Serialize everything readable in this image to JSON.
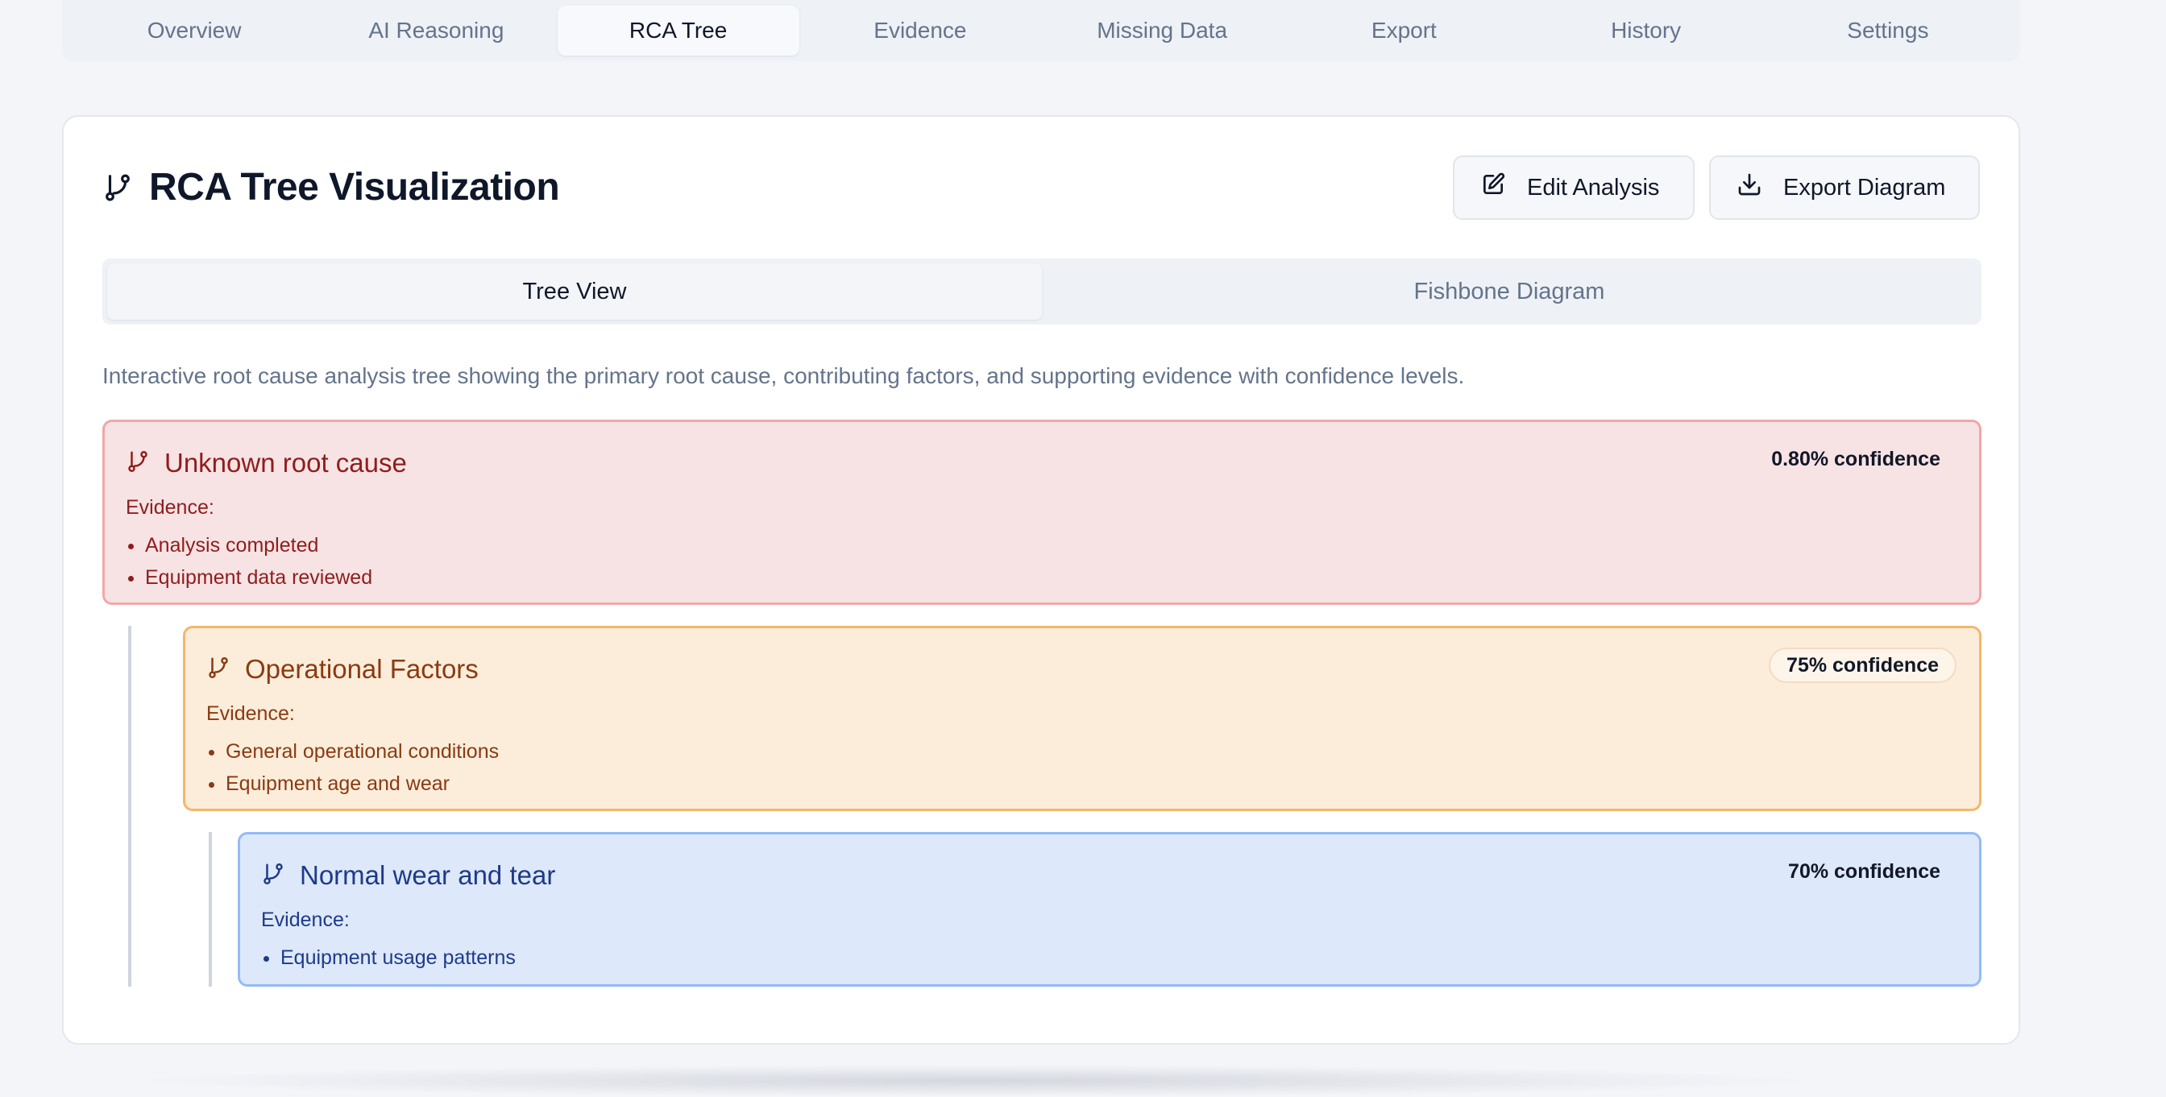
{
  "topnav": {
    "tabs": [
      {
        "label": "Overview"
      },
      {
        "label": "AI Reasoning"
      },
      {
        "label": "RCA Tree"
      },
      {
        "label": "Evidence"
      },
      {
        "label": "Missing Data"
      },
      {
        "label": "Export"
      },
      {
        "label": "History"
      },
      {
        "label": "Settings"
      }
    ],
    "active": "RCA Tree"
  },
  "card": {
    "title": "RCA Tree Visualization",
    "title_icon": "git-branch-icon",
    "edit_label": "Edit Analysis",
    "edit_icon": "edit-icon",
    "export_label": "Export Diagram",
    "export_icon": "download-icon"
  },
  "view_tabs": {
    "tree": "Tree View",
    "fishbone": "Fishbone Diagram",
    "active": "Tree View"
  },
  "description": "Interactive root cause analysis tree showing the primary root cause, contributing factors, and supporting evidence with confidence levels.",
  "tree": {
    "root": {
      "title": "Unknown root cause",
      "confidence": "0.80% confidence",
      "evidence_label": "Evidence:",
      "evidence": [
        "Analysis completed",
        "Equipment data reviewed"
      ],
      "color": "#8f1d1d"
    },
    "factor": {
      "title": "Operational Factors",
      "confidence": "75% confidence",
      "evidence_label": "Evidence:",
      "evidence": [
        "General operational conditions",
        "Equipment age and wear"
      ],
      "color": "#8a3a12"
    },
    "cause": {
      "title": "Normal wear and tear",
      "confidence": "70% confidence",
      "evidence_label": "Evidence:",
      "evidence": [
        "Equipment usage patterns"
      ],
      "color": "#1e3a8a"
    }
  }
}
